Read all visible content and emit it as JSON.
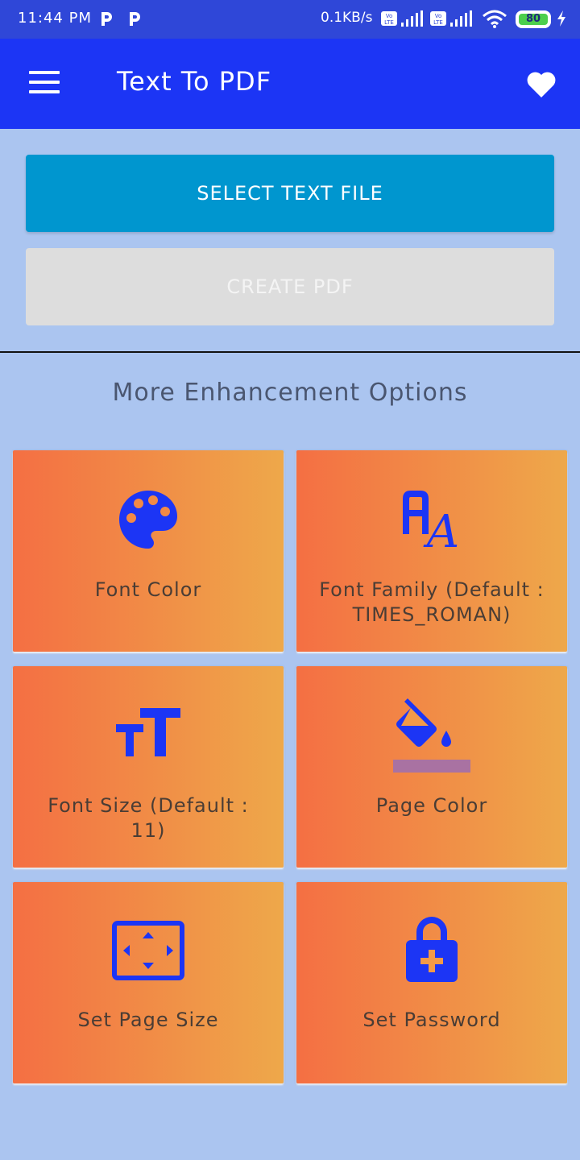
{
  "status_bar": {
    "time": "11:44 PM",
    "notif_icons": [
      "p-icon",
      "p-icon"
    ],
    "net_speed": "0.1KB/s",
    "battery": "80",
    "icons": [
      "volte-icon",
      "signal-icon",
      "volte-icon",
      "signal-icon",
      "wifi-icon",
      "battery-icon",
      "charging-icon"
    ]
  },
  "appbar": {
    "title": "Text To PDF",
    "menu_icon": "hamburger-menu-icon",
    "favorite_icon": "heart-icon",
    "color": "#1c35f5"
  },
  "buttons": {
    "select_label": "SELECT TEXT FILE",
    "create_label": "CREATE PDF"
  },
  "section": {
    "title": "More Enhancement Options"
  },
  "options": [
    {
      "label": "Font Color",
      "icon": "palette-icon"
    },
    {
      "label": "Font Family (Default : TIMES_ROMAN)",
      "icon": "font-family-icon"
    },
    {
      "label": "Font Size (Default : 11)",
      "icon": "text-size-icon"
    },
    {
      "label": "Page Color",
      "icon": "paint-bucket-icon"
    },
    {
      "label": "Set Page Size",
      "icon": "page-size-icon"
    },
    {
      "label": "Set Password",
      "icon": "lock-plus-icon"
    }
  ],
  "colors": {
    "background": "#abc5f0",
    "accent_blue": "#1c35f5",
    "select_button": "#0096cf",
    "card_gradient_start": "#f46f43",
    "card_gradient_end": "#eea84a"
  }
}
